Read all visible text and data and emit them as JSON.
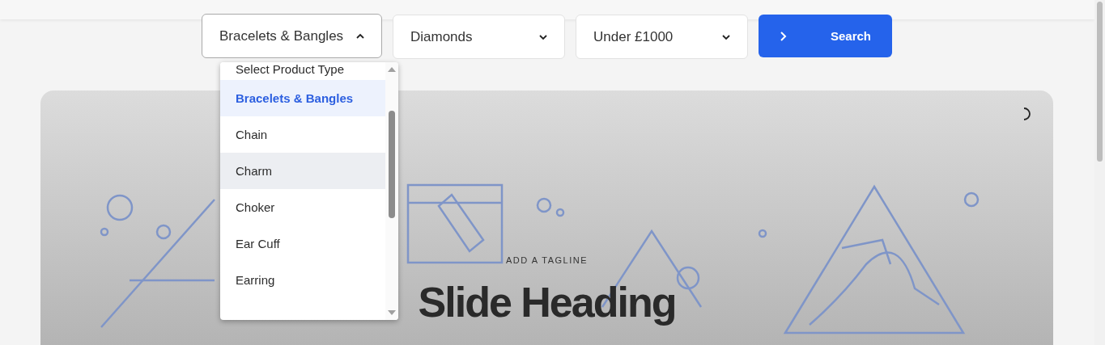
{
  "search_bar": {
    "selects": [
      {
        "value": "Bracelets & Bangles",
        "expanded": true
      },
      {
        "value": "Diamonds",
        "expanded": false
      },
      {
        "value": "Under £1000",
        "expanded": false
      }
    ],
    "button": "Search"
  },
  "dropdown": {
    "options": [
      {
        "label": "Select Product Type",
        "selected": false,
        "hovered": false
      },
      {
        "label": "Bracelets & Bangles",
        "selected": true,
        "hovered": false
      },
      {
        "label": "Chain",
        "selected": false,
        "hovered": false
      },
      {
        "label": "Charm",
        "selected": false,
        "hovered": true
      },
      {
        "label": "Choker",
        "selected": false,
        "hovered": false
      },
      {
        "label": "Ear Cuff",
        "selected": false,
        "hovered": false
      },
      {
        "label": "Earring",
        "selected": false,
        "hovered": false
      }
    ]
  },
  "slide": {
    "tagline": "ADD A TAGLINE",
    "heading": "Slide Heading"
  }
}
